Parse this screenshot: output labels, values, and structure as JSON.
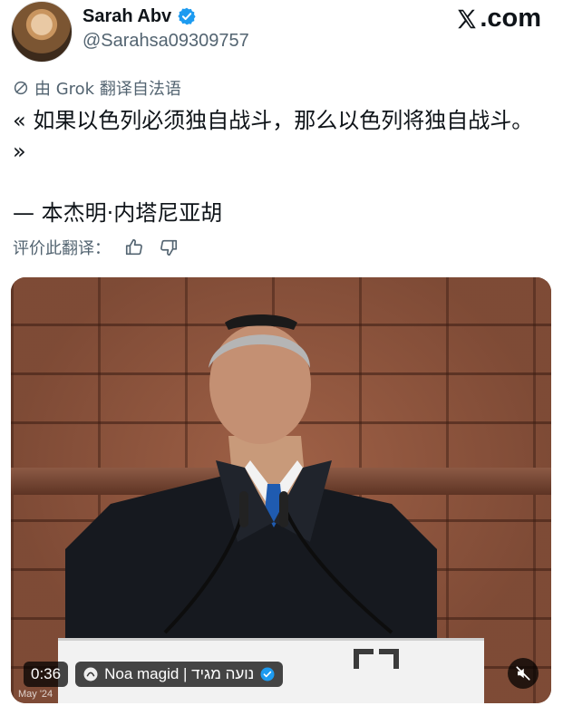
{
  "user": {
    "display_name": "Sarah Abv",
    "handle": "@Sarahsa09309757",
    "verified": true
  },
  "brand": {
    "text": ".com",
    "icon": "x-logo-icon"
  },
  "translation": {
    "label": "由 Grok 翻译自法语",
    "icon": "grok-icon"
  },
  "post": {
    "text": "« 如果以色列必须独自战斗，那么以色列将独自战斗。 »\n\n— 本杰明·内塔尼亚胡"
  },
  "rating": {
    "label": "评价此翻译：",
    "icons": [
      "thumbs-up-icon",
      "thumbs-down-icon"
    ]
  },
  "video": {
    "time": "0:36",
    "credit": "Noa magid | נועה מגיד",
    "stamp": "May '24",
    "mute_icon": "mute-icon"
  },
  "colors": {
    "text": "#0f1419",
    "muted": "#536471",
    "verified": "#1d9bf0"
  }
}
